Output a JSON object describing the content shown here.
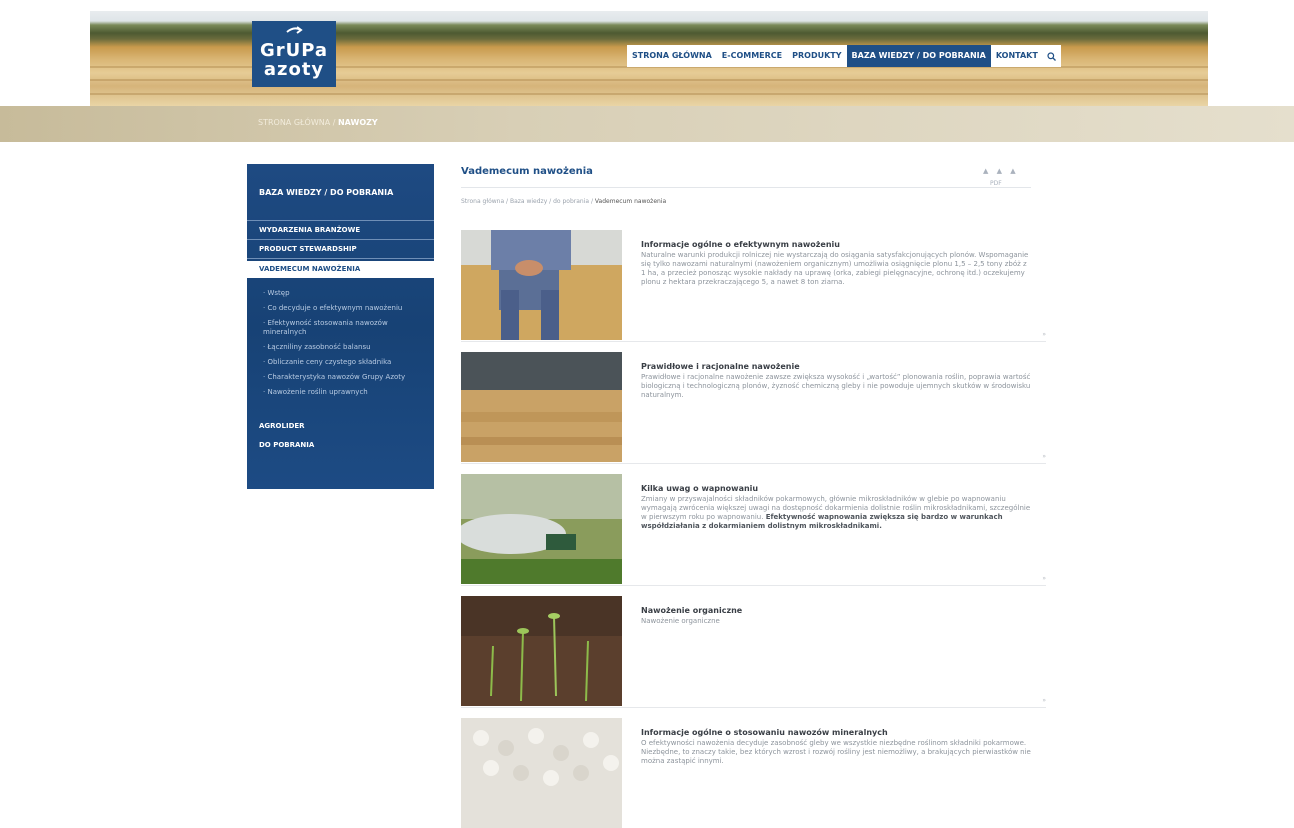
{
  "brand": {
    "line1": "GrUPa",
    "line2": "azoty"
  },
  "nav": {
    "items": [
      {
        "label": "STRONA GŁÓWNA",
        "active": false
      },
      {
        "label": "E-COMMERCE",
        "active": false
      },
      {
        "label": "PRODUKTY",
        "active": false
      },
      {
        "label": "BAZA WIEDZY / DO POBRANIA",
        "active": true
      },
      {
        "label": "KONTAKT",
        "active": false
      }
    ],
    "search_icon": "search-icon"
  },
  "breadcrumb_bar": {
    "path": "STRONA GŁÓWNA / ",
    "current": "NAWOZY"
  },
  "sidebar": {
    "title": "BAZA WIEDZY / DO POBRANIA",
    "items": [
      "WYDARZENIA BRANŻOWE",
      "PRODUCT STEWARDSHIP",
      "VADEMECUM NAWOŻENIA"
    ],
    "sub_items": [
      "Wstęp",
      "Co decyduje o efektywnym nawożeniu",
      "Efektywność stosowania nawozów mineralnych",
      "Łączniliny zasobność balansu",
      "Obliczanie ceny czystego składnika",
      "Charakterystyka nawozów Grupy Azoty",
      "Nawożenie roślin uprawnych"
    ],
    "bottom_items": [
      "AGROLIDER",
      "DO POBRANIA"
    ]
  },
  "content": {
    "title": "Vademecum nawożenia",
    "crumb": "Strona główna / Baza wiedzy / do pobrania / ",
    "crumb_current": "Vademecum nawożenia",
    "tools": "▲ ▲ ▲",
    "tools2": "PDF",
    "articles": [
      {
        "title": "Informacje ogólne o efektywnym nawożeniu",
        "text": "Naturalne warunki produkcji rolniczej nie wystarczają do osiągania satysfakcjonujących plonów. Wspomaganie się tylko nawozami naturalnymi (nawożeniem organicznym) umożliwia osiągnięcie plonu 1,5 – 2,5 tony zbóż z 1 ha, a przecież ponosząc wysokie nakłady na uprawę (orka, zabiegi pielęgnacyjne, ochronę itd.) oczekujemy plonu z hektara przekraczającego 5, a nawet 8 ton ziarna.",
        "bold": "",
        "more": "»"
      },
      {
        "title": "Prawidłowe i racjonalne nawożenie",
        "text": "Prawidłowe i racjonalne nawożenie zawsze zwiększa wysokość i „wartość” plonowania roślin, poprawia wartość biologiczną i technologiczną plonów, żyzność chemiczną gleby i nie powoduje ujemnych skutków w środowisku naturalnym.",
        "bold": "",
        "more": "»"
      },
      {
        "title": "Kilka uwag o wapnowaniu",
        "text": "Zmiany w przyswajalności składników pokarmowych, głównie mikroskładników w glebie po wapnowaniu wymagają zwrócenia większej uwagi na dostępność dokarmienia dolistnie roślin mikroskładnikami, szczególnie w pierwszym roku po wapnowaniu.",
        "bold": "Efektywność wapnowania zwiększa się bardzo w warunkach współdziałania z dokarmianiem dolistnym mikroskładnikami.",
        "more": "»"
      },
      {
        "title": "Nawożenie organiczne",
        "text": "Nawożenie organiczne",
        "bold": "",
        "more": "»"
      },
      {
        "title": "Informacje ogólne o stosowaniu nawozów mineralnych",
        "text": "O efektywności nawożenia decyduje zasobność gleby we wszystkie niezbędne roślinom składniki pokarmowe. Niezbędne, to znaczy takie, bez których wzrost i rozwój rośliny jest niemożliwy, a brakujących pierwiastków nie można zastąpić innymi.",
        "bold": "",
        "more": ""
      }
    ]
  },
  "colors": {
    "brand_blue": "#1f4f86",
    "sidebar_blue": "#174275",
    "breadbar": "#d5ccb2"
  }
}
